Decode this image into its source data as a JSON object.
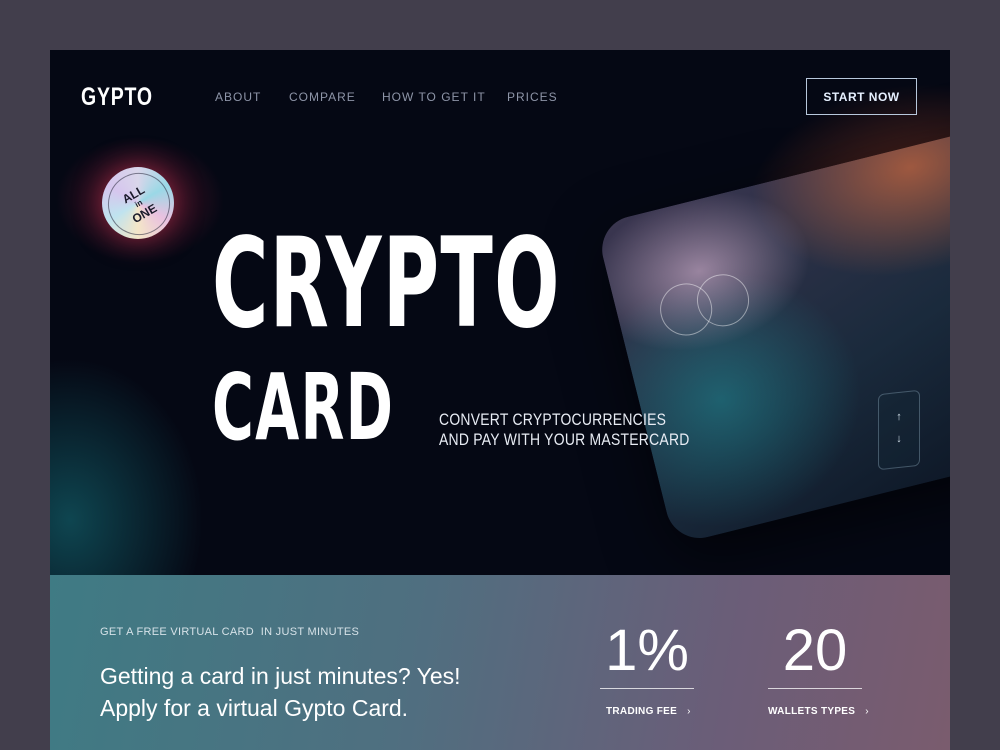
{
  "brand": {
    "logo": "GYPTO"
  },
  "nav": {
    "items": [
      {
        "label": "ABOUT"
      },
      {
        "label": "COMPARE"
      },
      {
        "label": "HOW TO GET IT"
      },
      {
        "label": "PRICES"
      }
    ],
    "cta_label": "START NOW"
  },
  "hero": {
    "badge": {
      "line1": "ALL",
      "line2": "in",
      "line3": "ONE"
    },
    "headline_line1": "CRYPTO",
    "headline_line2": "CARD",
    "tagline_line1": "CONVERT CRYPTOCURRENCIES",
    "tagline_line2": "AND PAY WITH YOUR MASTERCARD",
    "scroll_up_icon": "arrow-up-icon",
    "scroll_down_icon": "arrow-down-icon"
  },
  "info": {
    "eyebrow": "GET A FREE VIRTUAL CARD  IN JUST MINUTES",
    "lead_line1": "Getting a card in just minutes? Yes!",
    "lead_line2": "Apply for a virtual Gypto Card."
  },
  "stats": [
    {
      "value": "1%",
      "label": "TRADING FEE",
      "icon": "chevron-right-icon"
    },
    {
      "value": "20",
      "label": "WALLETS TYPES",
      "icon": "chevron-right-icon"
    }
  ],
  "colors": {
    "page_bg": "#423e4c",
    "hero_bg": "#050814",
    "accent_orange": "#c8502a",
    "accent_teal": "#1e8c96"
  }
}
